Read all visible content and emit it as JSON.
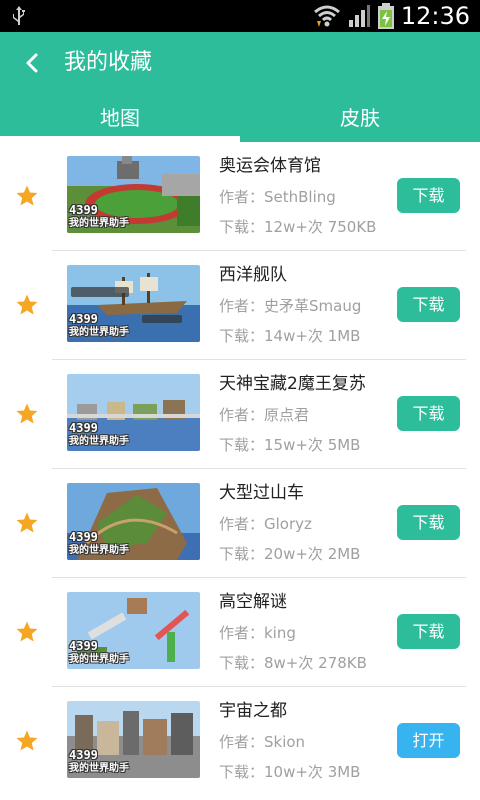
{
  "status_bar": {
    "time": "12:36",
    "icons": [
      "usb-icon",
      "wifi-icon",
      "signal-icon",
      "battery-charging-icon"
    ]
  },
  "header": {
    "title": "我的收藏",
    "back_icon": "chevron-left-icon",
    "tabs": [
      {
        "label": "地图",
        "active": true
      },
      {
        "label": "皮肤",
        "active": false
      }
    ]
  },
  "colors": {
    "accent": "#2dbd9b",
    "open_button": "#37b3f0",
    "star": "#f5a623"
  },
  "thumbnail_watermark": {
    "line1": "4399",
    "line2": "我的世界助手"
  },
  "items": [
    {
      "name": "奥运会体育馆",
      "author": "作者：SethBling",
      "stats": "下载：12w+次  750KB",
      "button": "下载",
      "button_type": "download"
    },
    {
      "name": "西洋舰队",
      "author": "作者：史矛革Smaug",
      "stats": "下载：14w+次  1MB",
      "button": "下载",
      "button_type": "download"
    },
    {
      "name": "天神宝藏2魔王复苏",
      "author": "作者：原点君",
      "stats": "下载：15w+次  5MB",
      "button": "下载",
      "button_type": "download"
    },
    {
      "name": "大型过山车",
      "author": "作者：Gloryz",
      "stats": "下载：20w+次  2MB",
      "button": "下载",
      "button_type": "download"
    },
    {
      "name": "高空解谜",
      "author": "作者：king",
      "stats": "下载：8w+次  278KB",
      "button": "下载",
      "button_type": "download"
    },
    {
      "name": "宇宙之都",
      "author": "作者：Skion",
      "stats": "下载：10w+次  3MB",
      "button": "打开",
      "button_type": "open"
    }
  ]
}
